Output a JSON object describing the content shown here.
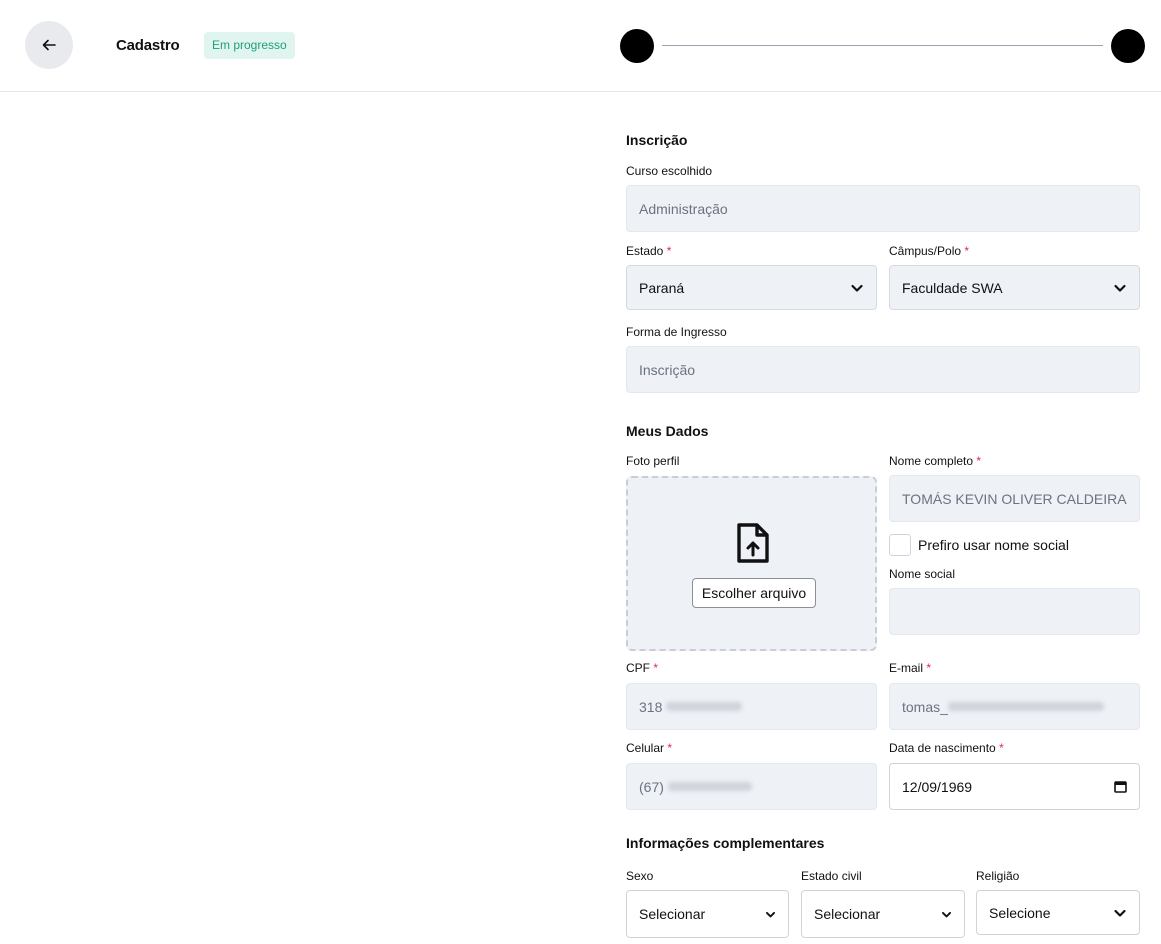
{
  "header": {
    "title": "Cadastro",
    "status": "Em progresso",
    "back_icon": "arrow-left-icon"
  },
  "inscricao": {
    "section_title": "Inscrição",
    "curso_label": "Curso escolhido",
    "curso_value": "Administração",
    "estado_label": "Estado",
    "estado_value": "Paraná",
    "campus_label": "Câmpus/Polo",
    "campus_value": "Faculdade SWA",
    "forma_label": "Forma de Ingresso",
    "forma_value": "Inscrição"
  },
  "meus_dados": {
    "section_title": "Meus Dados",
    "foto_label": "Foto perfil",
    "upload_icon": "file-upload-icon",
    "choose_file": "Escolher arquivo",
    "nome_label": "Nome completo",
    "nome_value": "TOMÁS KEVIN OLIVER CALDEIRA",
    "social_checkbox": "Prefiro usar nome social",
    "nome_social_label": "Nome social",
    "nome_social_value": "",
    "cpf_label": "CPF",
    "cpf_visible": "318",
    "email_label": "E-mail",
    "email_visible": "tomas_",
    "celular_label": "Celular",
    "celular_visible": "(67)",
    "nascimento_label": "Data de nascimento",
    "nascimento_value": "12/09/1969",
    "calendar_icon": "calendar-icon"
  },
  "complementares": {
    "section_title": "Informações complementares",
    "sexo_label": "Sexo",
    "sexo_value": "Selecionar",
    "civil_label": "Estado civil",
    "civil_value": "Selecionar",
    "religiao_label": "Religião",
    "religiao_value": "Selecione"
  },
  "required_mark": "*",
  "colors": {
    "badge_bg": "#e0f5ef",
    "badge_text": "#1e9e7a",
    "required": "#e0245e",
    "field_bg": "#eef1f6"
  }
}
